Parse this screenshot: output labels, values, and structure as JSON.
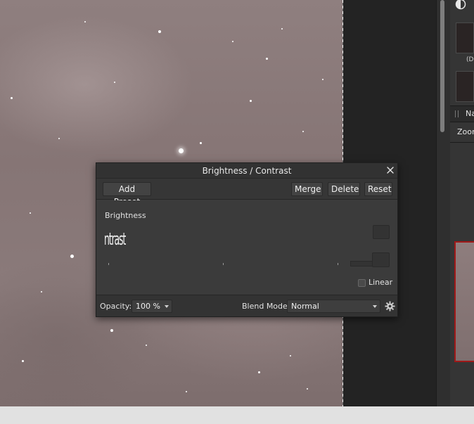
{
  "dialog": {
    "title": "Brightness / Contrast",
    "toolbar": {
      "add_preset": "Add Preset",
      "merge": "Merge",
      "delete": "Delete",
      "reset": "Reset"
    },
    "brightness_label": "Brightness",
    "contrast_label_glitched": "ntrast",
    "linear_label": "Linear",
    "linear_checked": false,
    "footer": {
      "opacity_label": "Opacity:",
      "opacity_value": "100 %",
      "blend_label": "Blend Mode:",
      "blend_value": "Normal"
    }
  },
  "right_panel": {
    "thumb1_label": "(D",
    "nav_tab_label": "Na",
    "zoom_label": "Zoom"
  },
  "colors": {
    "nav_preview_border": "#a01818",
    "dialog_bg": "#3b3b3b"
  }
}
